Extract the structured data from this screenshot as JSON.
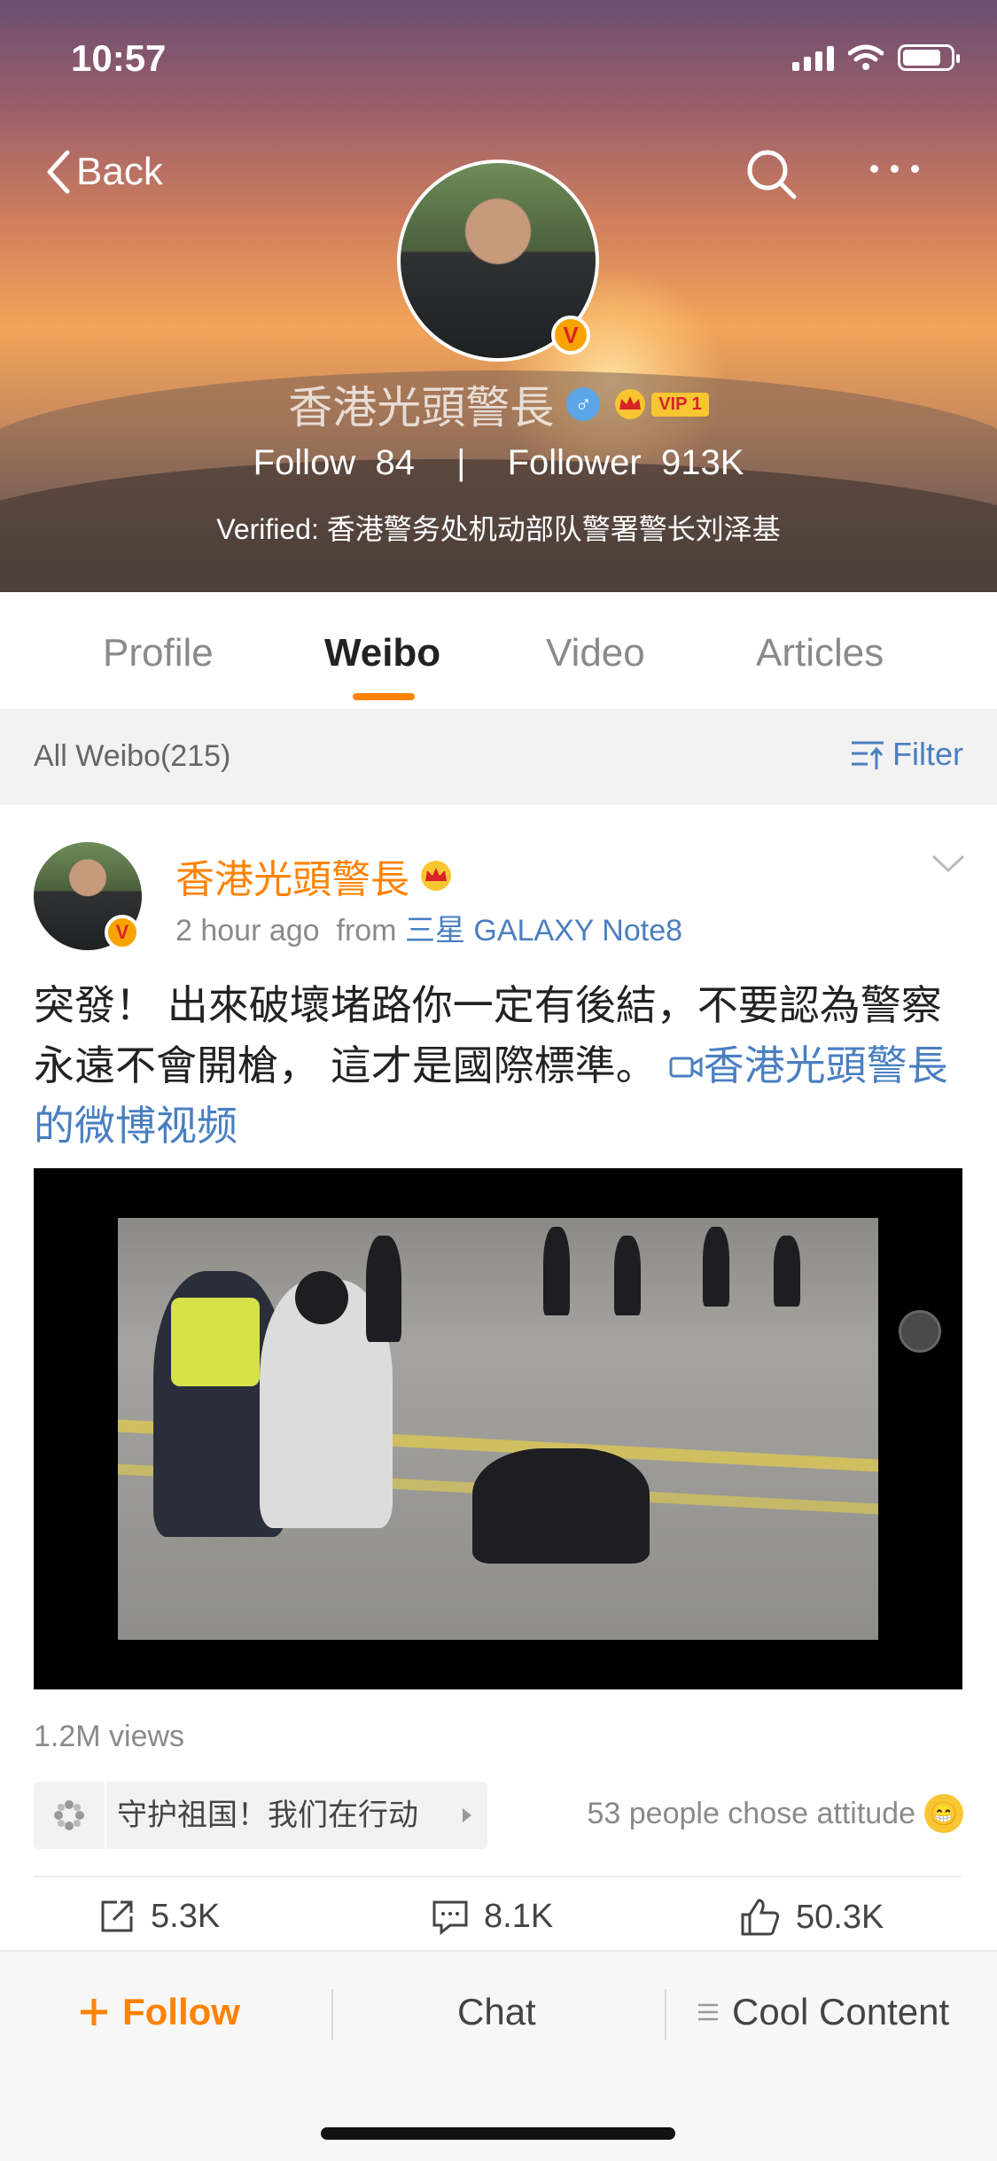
{
  "status_bar": {
    "time": "10:57"
  },
  "header": {
    "back_label": "Back",
    "name": "香港光頭警長",
    "vip_label": "VIP 1",
    "follow_label": "Follow",
    "follow_count": "84",
    "separator": "|",
    "follower_label": "Follower",
    "follower_count": "913K",
    "verified_text": "Verified: 香港警务处机动部队警署警长刘泽基"
  },
  "tabs": [
    "Profile",
    "Weibo",
    "Video",
    "Articles"
  ],
  "active_tab": "Weibo",
  "filter_bar": {
    "all_label": "All Weibo(215)",
    "filter_label": "Filter"
  },
  "post": {
    "author": "香港光頭警長",
    "time": "2 hour ago",
    "from_label": "from",
    "source": "三星 GALAXY Note8",
    "text": "突發！ 出來破壞堵路你一定有後結，不要認為警察永遠不會開槍， 這才是國際標準。",
    "link_text": "香港光頭警長的微博视频",
    "views": "1.2M views",
    "topic": "守护祖国！我们在行动",
    "attitude": "53 people chose attitude",
    "reposts": "5.3K",
    "comments": "8.1K",
    "likes": "50.3K"
  },
  "bottom_bar": {
    "follow": "Follow",
    "chat": "Chat",
    "cool_content": "Cool Content"
  },
  "colors": {
    "accent": "#ff8200",
    "link": "#4a7fc1"
  },
  "icons": [
    "back-chevron-icon",
    "search-icon",
    "more-icon",
    "verified-v-icon",
    "male-icon",
    "crown-icon",
    "filter-icon",
    "chevron-down-icon",
    "video-link-icon",
    "topic-icon",
    "grin-emoji-icon",
    "repost-icon",
    "comment-icon",
    "like-icon",
    "plus-icon",
    "menu-icon"
  ]
}
